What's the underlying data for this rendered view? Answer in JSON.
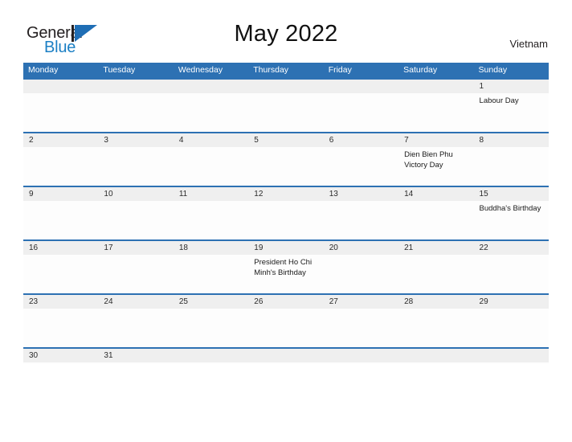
{
  "brand": {
    "word_one": "General",
    "word_two": "Blue",
    "logo_icon": "triangle-flag-icon",
    "accent_color": "#1f6eb5",
    "text_color": "#231f20"
  },
  "header": {
    "title": "May 2022",
    "country": "Vietnam"
  },
  "calendar": {
    "header_color": "#2d71b3",
    "band_color": "#efefef",
    "weekdays": [
      "Monday",
      "Tuesday",
      "Wednesday",
      "Thursday",
      "Friday",
      "Saturday",
      "Sunday"
    ],
    "weeks": [
      {
        "days": [
          {
            "date": "",
            "event": ""
          },
          {
            "date": "",
            "event": ""
          },
          {
            "date": "",
            "event": ""
          },
          {
            "date": "",
            "event": ""
          },
          {
            "date": "",
            "event": ""
          },
          {
            "date": "",
            "event": ""
          },
          {
            "date": "1",
            "event": "Labour Day"
          }
        ]
      },
      {
        "days": [
          {
            "date": "2",
            "event": ""
          },
          {
            "date": "3",
            "event": ""
          },
          {
            "date": "4",
            "event": ""
          },
          {
            "date": "5",
            "event": ""
          },
          {
            "date": "6",
            "event": ""
          },
          {
            "date": "7",
            "event": "Dien Bien Phu Victory Day"
          },
          {
            "date": "8",
            "event": ""
          }
        ]
      },
      {
        "days": [
          {
            "date": "9",
            "event": ""
          },
          {
            "date": "10",
            "event": ""
          },
          {
            "date": "11",
            "event": ""
          },
          {
            "date": "12",
            "event": ""
          },
          {
            "date": "13",
            "event": ""
          },
          {
            "date": "14",
            "event": ""
          },
          {
            "date": "15",
            "event": "Buddha's Birthday"
          }
        ]
      },
      {
        "days": [
          {
            "date": "16",
            "event": ""
          },
          {
            "date": "17",
            "event": ""
          },
          {
            "date": "18",
            "event": ""
          },
          {
            "date": "19",
            "event": "President Ho Chi Minh's Birthday"
          },
          {
            "date": "20",
            "event": ""
          },
          {
            "date": "21",
            "event": ""
          },
          {
            "date": "22",
            "event": ""
          }
        ]
      },
      {
        "days": [
          {
            "date": "23",
            "event": ""
          },
          {
            "date": "24",
            "event": ""
          },
          {
            "date": "25",
            "event": ""
          },
          {
            "date": "26",
            "event": ""
          },
          {
            "date": "27",
            "event": ""
          },
          {
            "date": "28",
            "event": ""
          },
          {
            "date": "29",
            "event": ""
          }
        ]
      },
      {
        "last": true,
        "days": [
          {
            "date": "30",
            "event": ""
          },
          {
            "date": "31",
            "event": ""
          },
          {
            "date": "",
            "event": ""
          },
          {
            "date": "",
            "event": ""
          },
          {
            "date": "",
            "event": ""
          },
          {
            "date": "",
            "event": ""
          },
          {
            "date": "",
            "event": ""
          }
        ]
      }
    ]
  }
}
